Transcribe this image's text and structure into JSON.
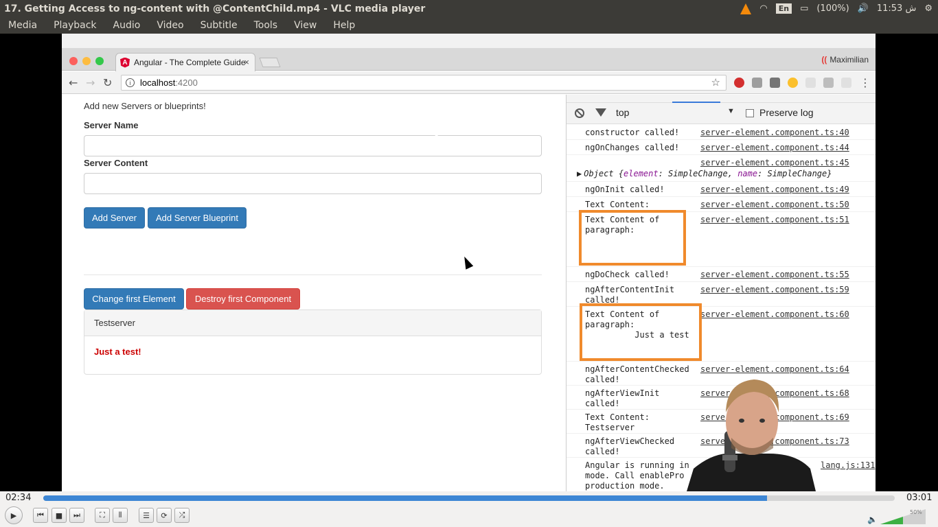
{
  "vlc": {
    "title": "17. Getting Access to ng-content with @ContentChild.mp4 - VLC media player",
    "tray": {
      "language": "En",
      "battery": "(100%)",
      "clock": "ش 11:53"
    },
    "menu": [
      "Media",
      "Playback",
      "Audio",
      "Video",
      "Subtitle",
      "Tools",
      "View",
      "Help"
    ],
    "elapsed": "02:34",
    "total": "03:01",
    "progress_fraction": 0.85,
    "volume": "50%"
  },
  "browser": {
    "tab_title": "Angular - The Complete Guide",
    "tab_close": "×",
    "profile_name": "Maximilian",
    "url_host": "localhost",
    "url_port": ":4200"
  },
  "app": {
    "lead": "Add new Servers or blueprints!",
    "server_name_label": "Server Name",
    "server_content_label": "Server Content",
    "add_server": "Add Server",
    "add_blueprint": "Add Server Blueprint",
    "change_first": "Change first Element",
    "destroy_first": "Destroy first Component",
    "panel_heading": "Testserver",
    "panel_body": "Just a test!"
  },
  "devtools": {
    "context": "top",
    "preserve_log": "Preserve log",
    "messages": [
      {
        "text": "constructor called!",
        "source": "server-element.component.ts:40"
      },
      {
        "text": "ngOnChanges called!",
        "source": "server-element.component.ts:44"
      },
      {
        "text": "",
        "source": "server-element.component.ts:45"
      },
      {
        "text": "ngOnInit called!",
        "source": "server-element.component.ts:49"
      },
      {
        "text": "Text Content:",
        "source": "server-element.component.ts:50"
      },
      {
        "text": "Text Content of\nparagraph:",
        "source": "server-element.component.ts:51"
      },
      {
        "text": "ngDoCheck called!",
        "source": "server-element.component.ts:55"
      },
      {
        "text": "ngAfterContentInit\ncalled!",
        "source": "server-element.component.ts:59"
      },
      {
        "text": "Text Content of\nparagraph:\n          Just a test",
        "source": "server-element.component.ts:60"
      },
      {
        "text": "ngAfterContentChecked\ncalled!",
        "source": "server-element.component.ts:64"
      },
      {
        "text": "ngAfterViewInit\ncalled!",
        "source": "server-element.component.ts:68"
      },
      {
        "text": "Text Content:\nTestserver",
        "source": "server-element.component.ts:69"
      },
      {
        "text": "ngAfterViewChecked\ncalled!",
        "source": "server-element.component.ts:73"
      },
      {
        "text": "Angular is running in\nmode. Call enablePro\nproduction mode.",
        "source": "lang.js:131"
      }
    ],
    "object_preview": {
      "prefix": "Object {",
      "k1": "element",
      "v1": ": SimpleChange, ",
      "k2": "name",
      "v2": ": SimpleChange}"
    }
  },
  "colors": {
    "accent_blue": "#337ab7",
    "danger_red": "#d9534f",
    "highlight_orange": "#f08a2c",
    "progress_blue": "#3d86d4"
  }
}
